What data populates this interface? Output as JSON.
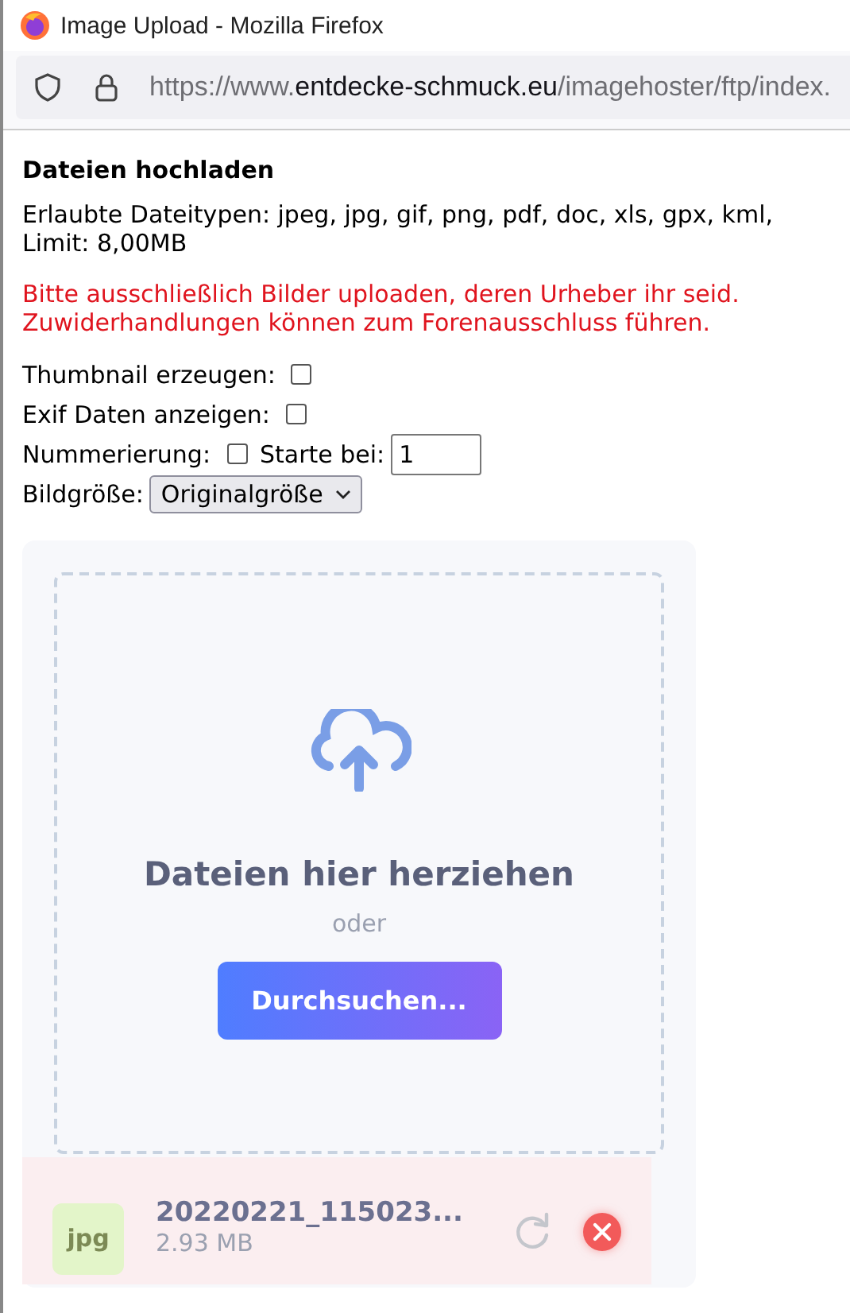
{
  "window": {
    "title": "Image Upload - Mozilla Firefox"
  },
  "address_bar": {
    "prefix": "https://www.",
    "domain": "entdecke-schmuck.eu",
    "path": "/imagehoster/ftp/index."
  },
  "page": {
    "heading": "Dateien hochladen",
    "info_lines": [
      "Erlaubte Dateitypen: jpeg, jpg, gif, png, pdf, doc, xls, gpx, kml,",
      "Limit: 8,00MB"
    ],
    "warning_lines": [
      "Bitte ausschließlich Bilder uploaden, deren Urheber ihr seid.",
      "Zuwiderhandlungen können zum Forenausschluss führen."
    ],
    "options": [
      {
        "kind": "checkbox",
        "label": "Thumbnail erzeugen:",
        "checked": false
      },
      {
        "kind": "checkbox",
        "label": "Exif Daten anzeigen:",
        "checked": false
      },
      {
        "kind": "checkbox_number",
        "label": "Nummerierung:",
        "checked": false,
        "field_label": "Starte bei:",
        "value": "1"
      },
      {
        "kind": "select",
        "label": "Bildgröße:",
        "value": "Originalgröße"
      }
    ]
  },
  "uploader": {
    "drop_text": "Dateien hier herziehen",
    "or_text": "oder",
    "browse_button": "Durchsuchen...",
    "files": [
      {
        "type": "jpg",
        "name": "20220221_115023...",
        "size": "2.93 MB"
      }
    ]
  }
}
